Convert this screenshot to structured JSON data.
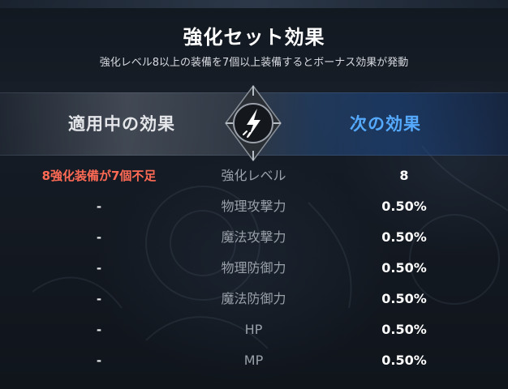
{
  "header": {
    "title": "強化セット効果",
    "subtitle": "強化レベル8以上の装備を7個以上装備するとボーナス効果が発動"
  },
  "tabs": {
    "current_label": "適用中の効果",
    "next_label": "次の効果",
    "center_icon": "lightning-bolt-icon"
  },
  "colors": {
    "next_tab": "#55aaff",
    "warning": "#ff6a55"
  },
  "rows": [
    {
      "current": "8強化装備が7個不足",
      "stat": "強化レベル",
      "next": "8"
    },
    {
      "current": "-",
      "stat": "物理攻撃力",
      "next": "0.50%"
    },
    {
      "current": "-",
      "stat": "魔法攻撃力",
      "next": "0.50%"
    },
    {
      "current": "-",
      "stat": "物理防御力",
      "next": "0.50%"
    },
    {
      "current": "-",
      "stat": "魔法防御力",
      "next": "0.50%"
    },
    {
      "current": "-",
      "stat": "HP",
      "next": "0.50%"
    },
    {
      "current": "-",
      "stat": "MP",
      "next": "0.50%"
    }
  ]
}
